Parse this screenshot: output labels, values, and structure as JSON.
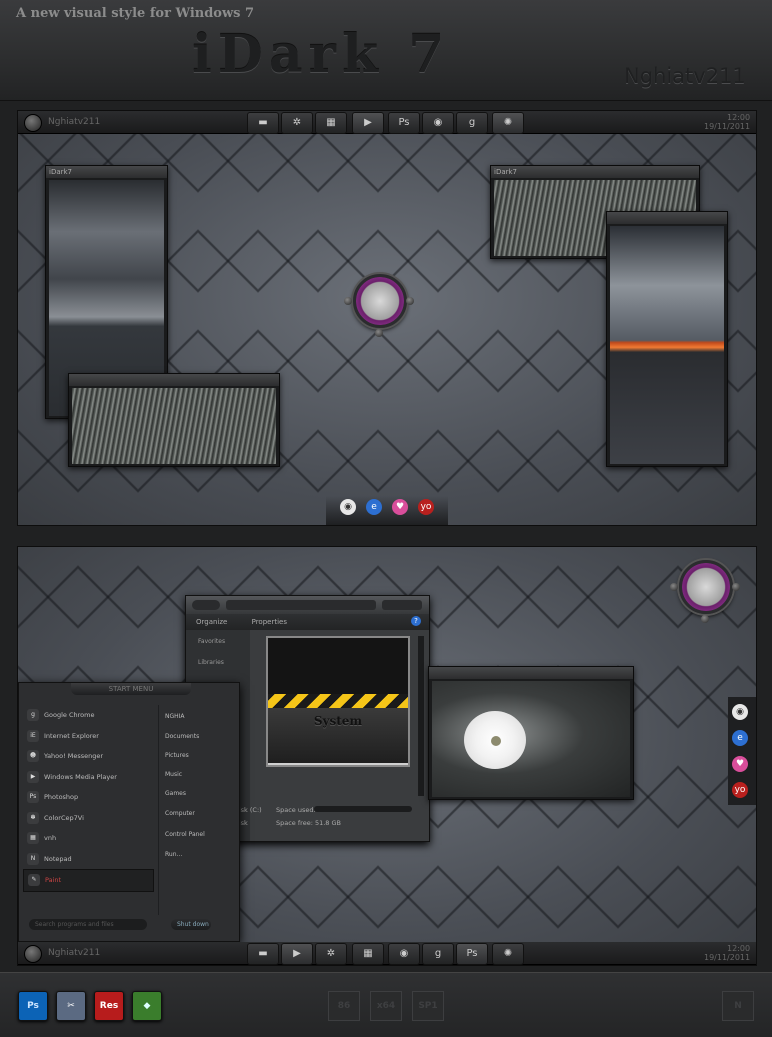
{
  "header": {
    "subtitle": "A new visual style for Windows 7",
    "title": "iDark 7",
    "author": "Nghiatv211"
  },
  "screen1": {
    "taskbar": {
      "user": "Nghiatv211",
      "buttons": [
        {
          "icon": "folder-icon"
        },
        {
          "icon": "yahoo-icon"
        },
        {
          "icon": "windows-icon"
        },
        {
          "icon": "play-icon"
        },
        {
          "label": "Ps"
        },
        {
          "icon": "chrome-icon"
        },
        {
          "label": "g"
        },
        {
          "icon": "colorcep-icon"
        }
      ],
      "clock": [
        "12:00",
        "19/11/2011"
      ]
    },
    "widgets": [
      {
        "title": "iDark7"
      },
      {
        "title": "iDark7"
      }
    ],
    "dock": [
      {
        "icon": "chrome-icon",
        "color": "#e8e8e8"
      },
      {
        "icon": "ie-icon",
        "color": "#2d6fd1"
      },
      {
        "icon": "heart-icon",
        "color": "#d94e9b"
      },
      {
        "icon": "yahoo-icon",
        "label": "yo",
        "color": "#b8201e"
      }
    ]
  },
  "screen2": {
    "explorer": {
      "toolbar": [
        "Organize",
        "Properties"
      ],
      "sidebar": [
        "Favorites",
        "Libraries"
      ],
      "drive_label": "System",
      "status_line1": "al Disk (C:)",
      "status_space_used": "Space used:",
      "status_line2": "al Disk",
      "status_space_free": "Space free: 51.8 GB"
    },
    "startmenu": {
      "header": "START MENU",
      "items": [
        {
          "label": "Google Chrome",
          "icon": "g"
        },
        {
          "label": "Internet Explorer",
          "icon": "iE"
        },
        {
          "label": "Yahoo! Messenger",
          "icon": "☻"
        },
        {
          "label": "Windows Media Player",
          "icon": "▶"
        },
        {
          "label": "Photoshop",
          "icon": "Ps"
        },
        {
          "label": "ColorCep7Vi",
          "icon": "✽"
        },
        {
          "label": "vnh",
          "icon": "▦"
        },
        {
          "label": "Notepad",
          "icon": "N"
        },
        {
          "label": "Paint",
          "icon": "✎",
          "active": true
        }
      ],
      "right_items": [
        "NGHIA",
        "Documents",
        "Pictures",
        "Music",
        "Games",
        "Computer",
        "Control Panel",
        "Run..."
      ],
      "search_placeholder": "Search programs and files",
      "shutdown": "Shut down"
    },
    "taskbar": {
      "user": "Nghiatv211",
      "buttons": [
        {
          "icon": "folder-icon"
        },
        {
          "icon": "play-icon"
        },
        {
          "icon": "yahoo-icon"
        },
        {
          "icon": "windows-icon"
        },
        {
          "icon": "chrome-icon"
        },
        {
          "label": "g"
        },
        {
          "label": "Ps"
        },
        {
          "icon": "colorcep-icon"
        }
      ],
      "clock": [
        "12:00",
        "19/11/2011"
      ]
    }
  },
  "bottom": {
    "icons": [
      {
        "label": "Ps",
        "color": "#0c63b6"
      },
      {
        "label": "✂",
        "color": "#5b6a82"
      },
      {
        "label": "Res",
        "color": "#b71c1c"
      },
      {
        "label": "◆",
        "color": "#3a7d2c"
      }
    ],
    "badges": [
      "86",
      "x64",
      "SP1"
    ],
    "corner": "N"
  }
}
